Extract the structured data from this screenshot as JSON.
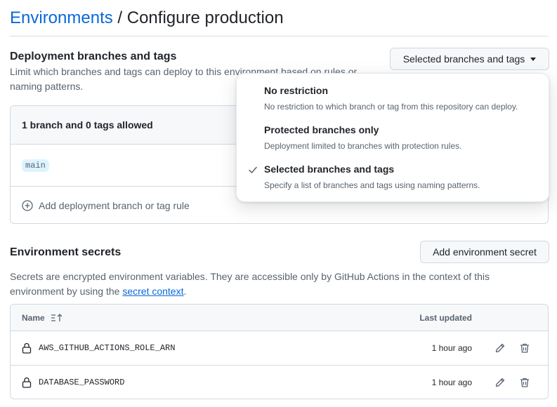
{
  "breadcrumb": {
    "parent": "Environments",
    "separator": "/",
    "current": "Configure production"
  },
  "deployment": {
    "title": "Deployment branches and tags",
    "description": "Limit which branches and tags can deploy to this environment based on rules or naming patterns.",
    "selector_label": "Selected branches and tags",
    "allowed_summary": "1 branch and 0 tags allowed",
    "branches": [
      "main"
    ],
    "add_rule_label": "Add deployment branch or tag rule"
  },
  "dropdown": {
    "items": [
      {
        "title": "No restriction",
        "desc": "No restriction to which branch or tag from this repository can deploy.",
        "selected": false
      },
      {
        "title": "Protected branches only",
        "desc": "Deployment limited to branches with protection rules.",
        "selected": false
      },
      {
        "title": "Selected branches and tags",
        "desc": "Specify a list of branches and tags using naming patterns.",
        "selected": true
      }
    ]
  },
  "secrets": {
    "title": "Environment secrets",
    "add_button": "Add environment secret",
    "desc_before": "Secrets are encrypted environment variables. They are accessible only by GitHub Actions in the context of this environment by using the ",
    "desc_link": "secret context",
    "desc_after": ".",
    "col_name": "Name",
    "col_updated": "Last updated",
    "rows": [
      {
        "name": "AWS_GITHUB_ACTIONS_ROLE_ARN",
        "updated": "1 hour ago"
      },
      {
        "name": "DATABASE_PASSWORD",
        "updated": "1 hour ago"
      }
    ]
  },
  "colors": {
    "link": "#0969da",
    "border": "#d1d9e0",
    "muted": "#59636e",
    "branch_bg": "#ddf4ff"
  },
  "icons": [
    "lock-icon",
    "pencil-icon",
    "trash-icon",
    "plus-circle-icon",
    "sort-icon",
    "check-icon",
    "caret-down-icon"
  ]
}
